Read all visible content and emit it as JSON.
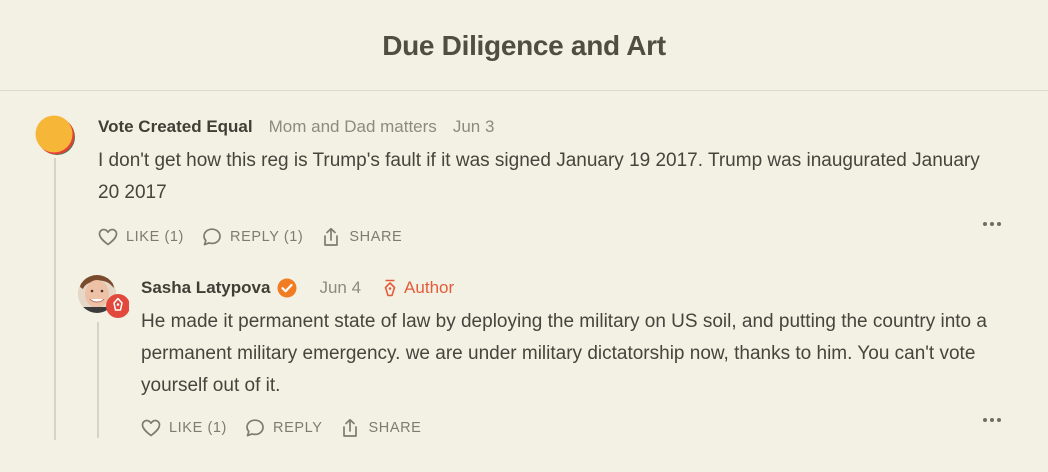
{
  "header": {
    "publication_title": "Due Diligence and Art"
  },
  "comments": [
    {
      "author": "Vote Created Equal",
      "subtitle": "Mom and Dad matters",
      "date": "Jun 3",
      "body": "I don't get how this reg is Trump's fault if it was signed January 19 2017. Trump was inaugurated January 20 2017",
      "actions": {
        "like": "LIKE (1)",
        "reply": "REPLY (1)",
        "share": "SHARE"
      },
      "avatar_icon": "orange-circle-avatar-icon"
    },
    {
      "author": "Sasha Latypova",
      "date": "Jun 4",
      "badge": "Author",
      "verified_icon": "verified-check-icon",
      "body": "He made it permanent state of law by deploying the military on US soil, and putting the country into a permanent military emergency. we are under military dictatorship now, thanks to him. You can't vote yourself out of it.",
      "actions": {
        "like": "LIKE (1)",
        "reply": "REPLY",
        "share": "SHARE"
      },
      "avatar_icon": "photo-avatar-icon"
    }
  ],
  "colors": {
    "background": "#f3f1e3",
    "accent_orange": "#f07c23",
    "author_red": "#e25c3c"
  }
}
